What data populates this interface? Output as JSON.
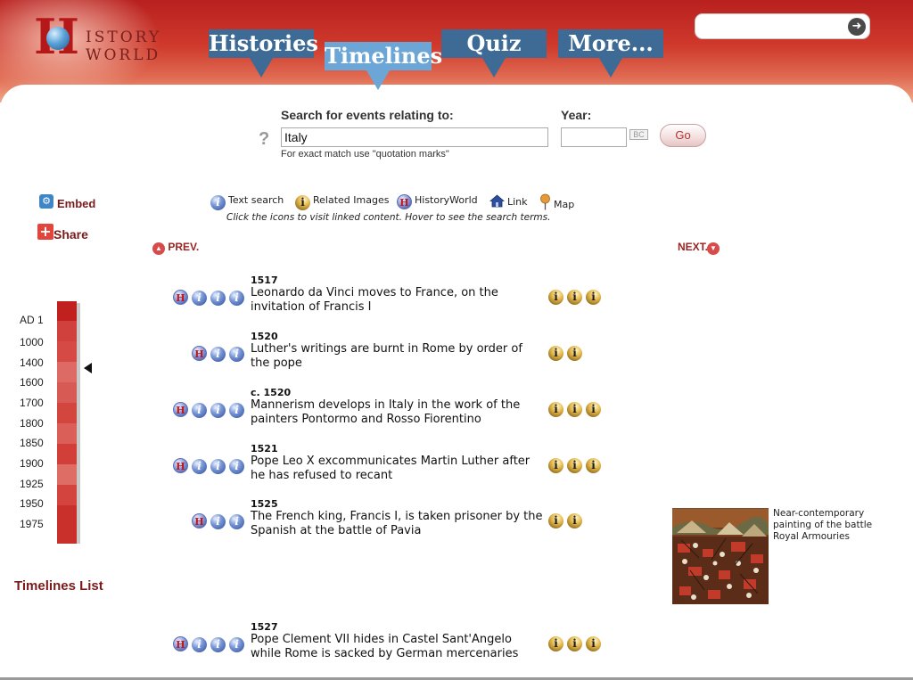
{
  "brand": {
    "logo_initial": "H",
    "logo_line1": "ISTORY",
    "logo_line2": "WORLD"
  },
  "nav": {
    "tabs": [
      {
        "label": "Histories",
        "active": false
      },
      {
        "label": "Timelines",
        "active": true
      },
      {
        "label": "Quiz",
        "active": false
      },
      {
        "label": "More...",
        "active": false
      }
    ]
  },
  "site_search": {
    "value": "",
    "go_icon": "arrow-right-circle-icon"
  },
  "search": {
    "label": "Search for events relating to:",
    "value": "Italy",
    "year_label": "Year:",
    "year_value": "",
    "bc_label": "BC",
    "go_label": "Go",
    "hint": "For exact match use \"quotation marks\"",
    "help_icon": "?"
  },
  "side": {
    "embed_label": "Embed",
    "share_label": "Share",
    "timelines_list_label": "Timelines List"
  },
  "legend": {
    "items": [
      {
        "icon": "info-icon",
        "label": "Text search"
      },
      {
        "icon": "image-icon",
        "label": "Related Images"
      },
      {
        "icon": "historyworld-icon",
        "label": "HistoryWorld"
      },
      {
        "icon": "house-link-icon",
        "label": "Link"
      },
      {
        "icon": "map-pin-icon",
        "label": "Map"
      }
    ],
    "caption": "Click the icons to visit linked content. Hover to see the search terms."
  },
  "pager": {
    "prev_label": "PREV.",
    "next_label": "NEXT."
  },
  "scale": {
    "labels": [
      "AD 1",
      "1000",
      "1400",
      "1600",
      "1700",
      "1800",
      "1850",
      "1900",
      "1925",
      "1950",
      "1975"
    ],
    "selected": "1400",
    "colors": [
      "#c0201e",
      "#d0403c",
      "#d54a44",
      "#dd6a64",
      "#d85a55",
      "#d3463f",
      "#da5f58",
      "#d23f39",
      "#de6d66",
      "#d4443e",
      "#c92f2b"
    ]
  },
  "events": [
    {
      "date": "1517",
      "text": "Leonardo da Vinci moves to France, on the invitation of Francis I",
      "left_icons": [
        "H",
        "i",
        "i",
        "i"
      ],
      "image_count": 3
    },
    {
      "date": "1520",
      "text": "Luther's writings are burnt in Rome by order of the pope",
      "left_icons": [
        "H",
        "i",
        "i"
      ],
      "image_count": 2
    },
    {
      "date": "c. 1520",
      "text": "Mannerism develops in Italy in the work of the painters Pontormo and Rosso Fiorentino",
      "left_icons": [
        "H",
        "i",
        "i",
        "i"
      ],
      "image_count": 3
    },
    {
      "date": "1521",
      "text": "Pope Leo X excommunicates Martin Luther after he has refused to recant",
      "left_icons": [
        "H",
        "i",
        "i",
        "i"
      ],
      "image_count": 3
    },
    {
      "date": "1525",
      "text": "The French king, Francis I, is taken prisoner by the Spanish at the battle of Pavia",
      "left_icons": [
        "H",
        "i",
        "i"
      ],
      "image_count": 2
    },
    {
      "date": "1527",
      "text": "Pope Clement VII hides in Castel Sant'Angelo while Rome is sacked by German mercenaries",
      "left_icons": [
        "H",
        "i",
        "i",
        "i"
      ],
      "image_count": 3
    }
  ],
  "featured_image": {
    "caption_line1": "Near-contemporary painting of the battle",
    "caption_line2": "Royal Armouries"
  }
}
